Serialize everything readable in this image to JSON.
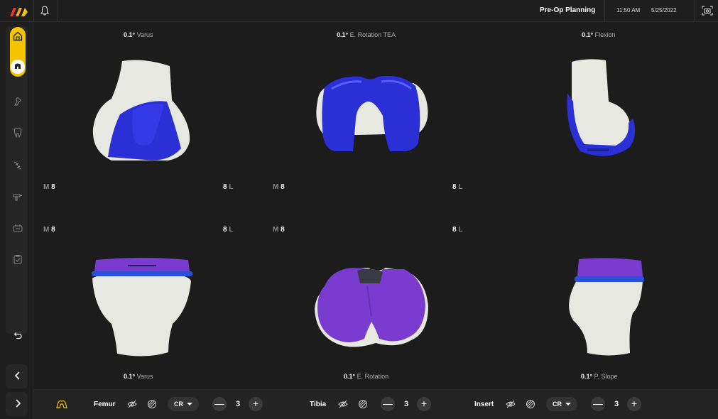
{
  "header": {
    "title": "Pre-Op Planning",
    "time": "11:50 AM",
    "date": "5/25/2022",
    "icons": [
      "logo-icon",
      "bell-icon",
      "camera-icon"
    ],
    "accent_colors": [
      "#e8392c",
      "#f5a623",
      "#f5c400"
    ]
  },
  "sidebar": {
    "icons": [
      "home-icon",
      "implant-icon",
      "bone-icon",
      "tooth-icon",
      "ligament-icon",
      "drill-icon",
      "balance-icon",
      "checklist-icon",
      "undo-icon",
      "chevron-left-icon",
      "chevron-right-icon"
    ],
    "active_color": "#f5c400"
  },
  "views": {
    "top_left": {
      "value": "0.1°",
      "label": "Varus"
    },
    "top_center": {
      "value": "0.1°",
      "label": "E. Rotation TEA"
    },
    "top_right": {
      "value": "0.1°",
      "label": "Flexion"
    },
    "bottom_left": {
      "value": "0.1°",
      "label": "Varus"
    },
    "bottom_center": {
      "value": "0.1°",
      "label": "E. Rotation"
    },
    "bottom_right": {
      "value": "0.1°",
      "label": "P. Slope"
    }
  },
  "markers": {
    "m_letter": "M",
    "l_letter": "L",
    "row1": {
      "m1": "8",
      "l1": "8",
      "m2": "8",
      "l2": "8"
    },
    "row2": {
      "m1": "8",
      "l1": "8",
      "m2": "8",
      "l2": "8"
    }
  },
  "bottom": {
    "femur": {
      "label": "Femur",
      "type": "CR",
      "count": "3"
    },
    "tibia": {
      "label": "Tibia",
      "count": "3"
    },
    "insert": {
      "label": "Insert",
      "type": "CR",
      "count": "3"
    },
    "minus": "—",
    "plus": "+"
  },
  "colors": {
    "bone": "#e8e8e2",
    "femoral_implant": "#2a2fd6",
    "tibial_insert": "#7a3bd0",
    "tibial_tray": "#2850d8"
  }
}
